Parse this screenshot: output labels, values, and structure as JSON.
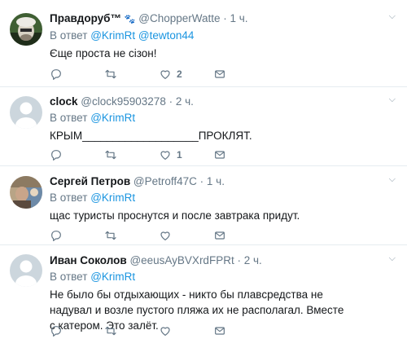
{
  "reply_prefix": "В ответ",
  "tweets": [
    {
      "name": "Правдоруб™",
      "badge": "🐾",
      "handle": "@ChopperWatte",
      "time": "1 ч.",
      "mentions": [
        "@KrimRt",
        "@tewton44"
      ],
      "text": "Єще проста не сізон!",
      "reply_count": "",
      "retweet_count": "",
      "like_count": "2"
    },
    {
      "name": "clock",
      "handle": "@clock95903278",
      "time": "2 ч.",
      "mentions": [
        "@KrimRt"
      ],
      "text": "КРЫМ___________________ПРОКЛЯТ.",
      "reply_count": "",
      "retweet_count": "",
      "like_count": "1"
    },
    {
      "name": "Сергей Петров",
      "handle": "@Petroff47C",
      "time": "1 ч.",
      "mentions": [
        "@KrimRt"
      ],
      "text": "щас туристы проснутся и после завтрака придут.",
      "reply_count": "",
      "retweet_count": "",
      "like_count": ""
    },
    {
      "name": "Иван Соколов",
      "handle": "@eeusAyBVXrdFPRt",
      "time": "2 ч.",
      "mentions": [
        "@KrimRt"
      ],
      "text": "Не было бы отдыхающих - никто бы плавсредства не надувал и возле пустого пляжа их не располагал. Вместе с катером. Это залёт.",
      "reply_count": "",
      "retweet_count": "",
      "like_count": ""
    }
  ],
  "icons": {
    "reply": "reply-icon",
    "retweet": "retweet-icon",
    "like": "heart-icon",
    "dm": "envelope-icon",
    "menu": "chevron-down-icon"
  },
  "colors": {
    "link": "#1b95e0",
    "secondary": "#657786",
    "divider": "#e6ecf0"
  }
}
